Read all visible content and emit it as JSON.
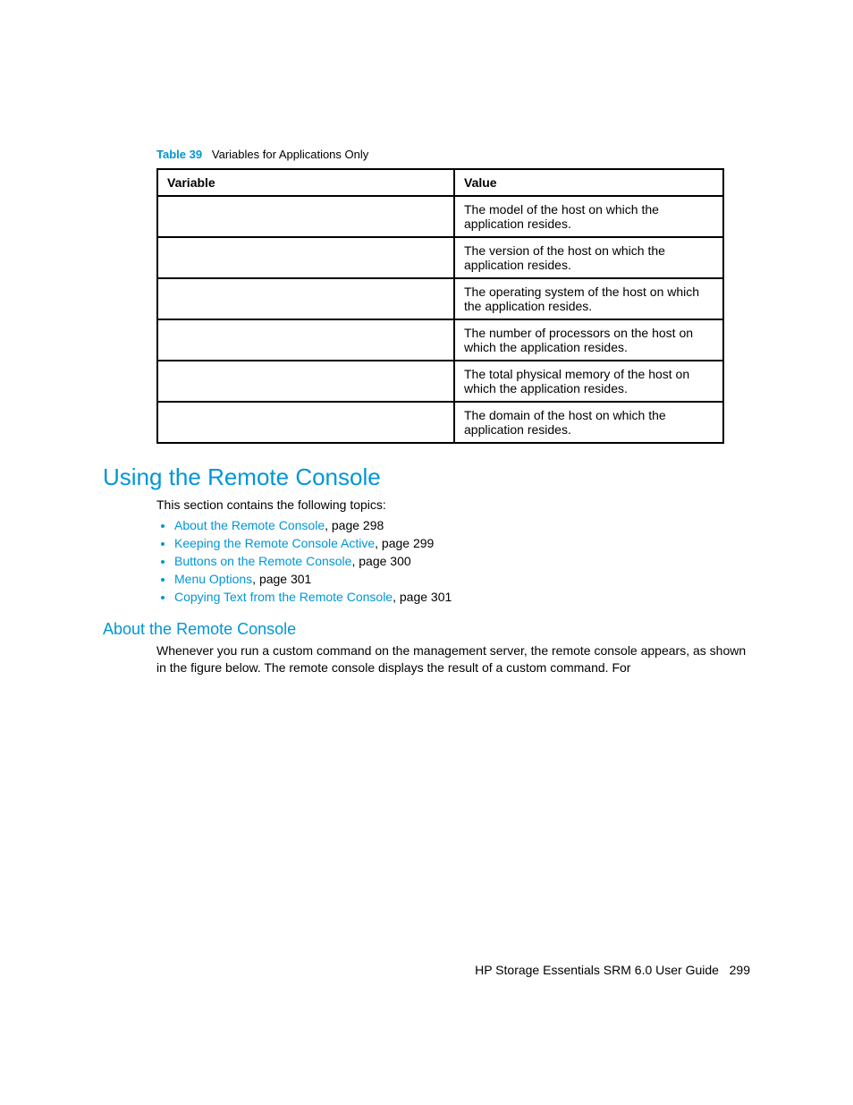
{
  "tableCaptionLabel": "Table 39",
  "tableCaptionText": "Variables for Applications Only",
  "table": {
    "headers": {
      "col1": "Variable",
      "col2": "Value"
    },
    "rows": [
      {
        "variable": "",
        "value": "The model of the host on which the application resides."
      },
      {
        "variable": "",
        "value": "The version of the host on which the application resides."
      },
      {
        "variable": "",
        "value": "The operating system of the host on which the application resides."
      },
      {
        "variable": "",
        "value": "The number of processors on the host on which the application resides."
      },
      {
        "variable": "",
        "value": "The total physical memory of the host on which the application resides."
      },
      {
        "variable": "",
        "value": "The domain of the host on which the application resides."
      }
    ]
  },
  "heading1": "Using the Remote Console",
  "intro": "This section contains the following topics:",
  "topics": [
    {
      "link": "About the Remote Console",
      "suffix": ", page 298"
    },
    {
      "link": "Keeping the Remote Console Active",
      "suffix": ", page 299"
    },
    {
      "link": "Buttons on the Remote Console",
      "suffix": ", page 300"
    },
    {
      "link": "Menu Options",
      "suffix": ", page 301"
    },
    {
      "link": "Copying Text from the Remote Console",
      "suffix": ", page 301"
    }
  ],
  "heading2": "About the Remote Console",
  "body2": "Whenever you run a custom command on the management server, the remote console appears, as shown in the figure below. The remote console displays the result of a custom command. For",
  "footer": {
    "title": "HP Storage Essentials SRM 6.0 User Guide",
    "pagenum": "299"
  }
}
